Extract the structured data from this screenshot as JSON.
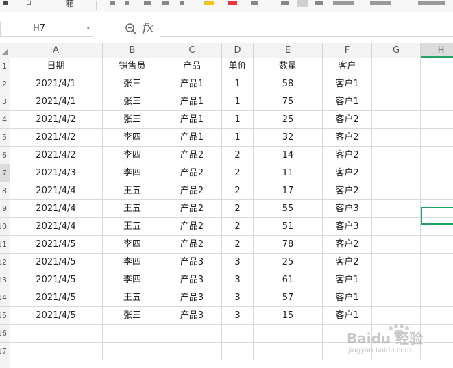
{
  "formula_bar": {
    "cell_ref": "H7",
    "formula": "",
    "fx_label": "fx"
  },
  "ribbon": {
    "fragment_text": "箱"
  },
  "grid": {
    "columns": [
      "A",
      "B",
      "C",
      "D",
      "E",
      "F",
      "G",
      "H"
    ],
    "selected_column": "H",
    "row_numbers": [
      "1",
      "2",
      "3",
      "4",
      "5",
      "6",
      "7",
      "8",
      "9",
      "10",
      "11",
      "12",
      "13",
      "14",
      "15",
      "16",
      "17"
    ],
    "selected_row": "7",
    "header_row": [
      "日期",
      "销售员",
      "产品",
      "单价",
      "数量",
      "客户"
    ],
    "rows": [
      [
        "2021/4/1",
        "张三",
        "产品1",
        "1",
        "58",
        "客户1"
      ],
      [
        "2021/4/1",
        "张三",
        "产品1",
        "1",
        "75",
        "客户1"
      ],
      [
        "2021/4/2",
        "张三",
        "产品1",
        "1",
        "25",
        "客户2"
      ],
      [
        "2021/4/2",
        "李四",
        "产品1",
        "1",
        "32",
        "客户2"
      ],
      [
        "2021/4/2",
        "李四",
        "产品2",
        "2",
        "14",
        "客户2"
      ],
      [
        "2021/4/3",
        "李四",
        "产品2",
        "2",
        "11",
        "客户2"
      ],
      [
        "2021/4/4",
        "王五",
        "产品2",
        "2",
        "17",
        "客户2"
      ],
      [
        "2021/4/4",
        "王五",
        "产品2",
        "2",
        "55",
        "客户3"
      ],
      [
        "2021/4/4",
        "王五",
        "产品2",
        "2",
        "51",
        "客户3"
      ],
      [
        "2021/4/5",
        "李四",
        "产品2",
        "2",
        "78",
        "客户2"
      ],
      [
        "2021/4/5",
        "李四",
        "产品3",
        "3",
        "25",
        "客户2"
      ],
      [
        "2021/4/5",
        "李四",
        "产品3",
        "3",
        "61",
        "客户1"
      ],
      [
        "2021/4/5",
        "王五",
        "产品3",
        "3",
        "57",
        "客户1"
      ],
      [
        "2021/4/5",
        "张三",
        "产品3",
        "3",
        "15",
        "客户1"
      ]
    ]
  },
  "watermark": {
    "brand": "Baidu 经验",
    "url": "jingyan.baidu.com"
  },
  "colors": {
    "selection": "#21a366",
    "header_bg": "#f3f3f3",
    "gridline": "#d9d9d9"
  }
}
